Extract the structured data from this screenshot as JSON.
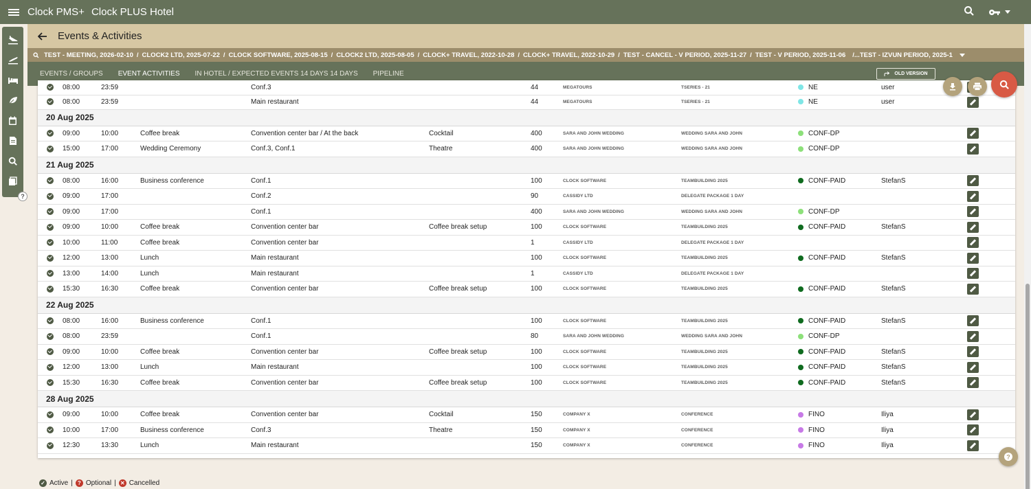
{
  "app": {
    "title": "Clock PMS+",
    "hotel": "Clock PLUS Hotel"
  },
  "page": {
    "title": "Events & Activities"
  },
  "breadcrumbs": [
    "TEST - MEETING, 2026-02-10",
    "CLOCK2 LTD, 2025-07-22",
    "CLOCK SOFTWARE, 2025-08-15",
    "CLOCK2 LTD, 2025-08-05",
    "CLOCK+ TRAVEL, 2022-10-28",
    "CLOCK+ TRAVEL, 2022-10-29",
    "TEST - CANCEL - V PERIOD, 2025-11-27",
    "TEST - V PERIOD, 2025-11-06",
    "/...TEST - IZVUN PERIOD, 2025-1"
  ],
  "tabs": [
    {
      "label": "EVENTS / GROUPS",
      "active": false
    },
    {
      "label": "EVENT ACTIVITIES",
      "active": true
    },
    {
      "label": "IN HOTEL / EXPECTED EVENTS 14 DAYS 14 DAYS",
      "active": false
    },
    {
      "label": "PIPELINE",
      "active": false
    }
  ],
  "old_version_label": "OLD VERSION",
  "colors": {
    "topbar": "#66725a",
    "subheader": "#d6c7a3",
    "crumbbar": "#9c8d6b",
    "conf_paid": "#0f6b1f",
    "conf_dp": "#8de07a",
    "ne": "#7fe6e6",
    "fino": "#c77ae6",
    "search_fab": "#d85a45"
  },
  "table": {
    "partial_rows": [
      {
        "start": "08:00",
        "end": "23:59",
        "activity": "",
        "venue": "Conf.3",
        "setup": "",
        "pax": "44",
        "company": "MEGATOURS",
        "event": "TSERIES - 21",
        "status": "NE",
        "status_color": "#7fe6e6",
        "user": "user"
      },
      {
        "start": "08:00",
        "end": "23:59",
        "activity": "",
        "venue": "Main restaurant",
        "setup": "",
        "pax": "44",
        "company": "MEGATOURS",
        "event": "TSERIES - 21",
        "status": "NE",
        "status_color": "#7fe6e6",
        "user": "user"
      }
    ],
    "groups": [
      {
        "date": "20 Aug 2025",
        "rows": [
          {
            "start": "09:00",
            "end": "10:00",
            "activity": "Coffee break",
            "venue": "Convention center bar / At the back",
            "setup": "Cocktail",
            "pax": "400",
            "company": "SARA AND JOHN WEDDING",
            "event": "WEDDING SARA AND JOHN",
            "status": "CONF-DP",
            "status_color": "#8de07a",
            "user": ""
          },
          {
            "start": "15:00",
            "end": "17:00",
            "activity": "Wedding Ceremony",
            "venue": "Conf.3, Conf.1",
            "setup": "Theatre",
            "pax": "400",
            "company": "SARA AND JOHN WEDDING",
            "event": "WEDDING SARA AND JOHN",
            "status": "CONF-DP",
            "status_color": "#8de07a",
            "user": ""
          }
        ]
      },
      {
        "date": "21 Aug 2025",
        "rows": [
          {
            "start": "08:00",
            "end": "16:00",
            "activity": "Business conference",
            "venue": "Conf.1",
            "setup": "",
            "pax": "100",
            "company": "CLOCK SOFTWARE",
            "event": "TEAMBUILDING 2025",
            "status": "CONF-PAID",
            "status_color": "#0f6b1f",
            "user": "StefanS"
          },
          {
            "start": "09:00",
            "end": "17:00",
            "activity": "",
            "venue": "Conf.2",
            "setup": "",
            "pax": "90",
            "company": "CASSIDY LTD",
            "event": "DELEGATE PACKAGE 1 DAY",
            "status": "",
            "status_color": "",
            "user": ""
          },
          {
            "start": "09:00",
            "end": "17:00",
            "activity": "",
            "venue": "Conf.1",
            "setup": "",
            "pax": "400",
            "company": "SARA AND JOHN WEDDING",
            "event": "WEDDING SARA AND JOHN",
            "status": "CONF-DP",
            "status_color": "#8de07a",
            "user": ""
          },
          {
            "start": "09:00",
            "end": "10:00",
            "activity": "Coffee break",
            "venue": "Convention center bar",
            "setup": "Coffee break setup",
            "pax": "100",
            "company": "CLOCK SOFTWARE",
            "event": "TEAMBUILDING 2025",
            "status": "CONF-PAID",
            "status_color": "#0f6b1f",
            "user": "StefanS"
          },
          {
            "start": "10:00",
            "end": "11:00",
            "activity": "Coffee break",
            "venue": "Convention center bar",
            "setup": "",
            "pax": "1",
            "company": "CASSIDY LTD",
            "event": "DELEGATE PACKAGE 1 DAY",
            "status": "",
            "status_color": "",
            "user": ""
          },
          {
            "start": "12:00",
            "end": "13:00",
            "activity": "Lunch",
            "venue": "Main restaurant",
            "setup": "",
            "pax": "100",
            "company": "CLOCK SOFTWARE",
            "event": "TEAMBUILDING 2025",
            "status": "CONF-PAID",
            "status_color": "#0f6b1f",
            "user": "StefanS"
          },
          {
            "start": "13:00",
            "end": "14:00",
            "activity": "Lunch",
            "venue": "Main restaurant",
            "setup": "",
            "pax": "1",
            "company": "CASSIDY LTD",
            "event": "DELEGATE PACKAGE 1 DAY",
            "status": "",
            "status_color": "",
            "user": ""
          },
          {
            "start": "15:30",
            "end": "16:30",
            "activity": "Coffee break",
            "venue": "Convention center bar",
            "setup": "Coffee break setup",
            "pax": "100",
            "company": "CLOCK SOFTWARE",
            "event": "TEAMBUILDING 2025",
            "status": "CONF-PAID",
            "status_color": "#0f6b1f",
            "user": "StefanS"
          }
        ]
      },
      {
        "date": "22 Aug 2025",
        "rows": [
          {
            "start": "08:00",
            "end": "16:00",
            "activity": "Business conference",
            "venue": "Conf.1",
            "setup": "",
            "pax": "100",
            "company": "CLOCK SOFTWARE",
            "event": "TEAMBUILDING 2025",
            "status": "CONF-PAID",
            "status_color": "#0f6b1f",
            "user": "StefanS"
          },
          {
            "start": "08:00",
            "end": "23:59",
            "activity": "",
            "venue": "Conf.1",
            "setup": "",
            "pax": "80",
            "company": "SARA AND JOHN WEDDING",
            "event": "WEDDING SARA AND JOHN",
            "status": "CONF-DP",
            "status_color": "#8de07a",
            "user": ""
          },
          {
            "start": "09:00",
            "end": "10:00",
            "activity": "Coffee break",
            "venue": "Convention center bar",
            "setup": "Coffee break setup",
            "pax": "100",
            "company": "CLOCK SOFTWARE",
            "event": "TEAMBUILDING 2025",
            "status": "CONF-PAID",
            "status_color": "#0f6b1f",
            "user": "StefanS"
          },
          {
            "start": "12:00",
            "end": "13:00",
            "activity": "Lunch",
            "venue": "Main restaurant",
            "setup": "",
            "pax": "100",
            "company": "CLOCK SOFTWARE",
            "event": "TEAMBUILDING 2025",
            "status": "CONF-PAID",
            "status_color": "#0f6b1f",
            "user": "StefanS"
          },
          {
            "start": "15:30",
            "end": "16:30",
            "activity": "Coffee break",
            "venue": "Convention center bar",
            "setup": "Coffee break setup",
            "pax": "100",
            "company": "CLOCK SOFTWARE",
            "event": "TEAMBUILDING 2025",
            "status": "CONF-PAID",
            "status_color": "#0f6b1f",
            "user": "StefanS"
          }
        ]
      },
      {
        "date": "28 Aug 2025",
        "rows": [
          {
            "start": "09:00",
            "end": "10:00",
            "activity": "Coffee break",
            "venue": "Convention center bar",
            "setup": "Cocktail",
            "pax": "150",
            "company": "COMPANY X",
            "event": "CONFERENCE",
            "status": "FINO",
            "status_color": "#c77ae6",
            "user": "Iliya"
          },
          {
            "start": "10:00",
            "end": "17:00",
            "activity": "Business conference",
            "venue": "Conf.3",
            "setup": "Theatre",
            "pax": "150",
            "company": "COMPANY X",
            "event": "CONFERENCE",
            "status": "FINO",
            "status_color": "#c77ae6",
            "user": "Iliya"
          },
          {
            "start": "12:30",
            "end": "13:30",
            "activity": "Lunch",
            "venue": "Main restaurant",
            "setup": "",
            "pax": "150",
            "company": "COMPANY X",
            "event": "CONFERENCE",
            "status": "FINO",
            "status_color": "#c77ae6",
            "user": "Iliya"
          }
        ]
      }
    ]
  },
  "legend": {
    "active": "Active",
    "optional": "Optional",
    "cancelled": "Cancelled",
    "separator": "|"
  },
  "sidebar_icons": [
    "arrivals-icon",
    "departures-icon",
    "bed-icon",
    "leaf-icon",
    "calendar-icon",
    "document-icon",
    "search-icon",
    "book-icon"
  ]
}
